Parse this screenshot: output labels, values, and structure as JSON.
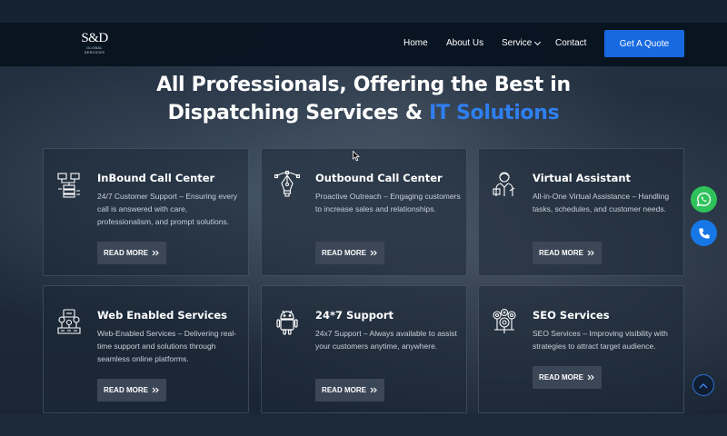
{
  "logo": {
    "mark": "S&D",
    "sub1": "GLOBAL",
    "sub2": "SERVICES"
  },
  "nav": {
    "home": "Home",
    "about": "About Us",
    "service": "Service",
    "contact": "Contact",
    "quote_button": "Get A Quote"
  },
  "heading": {
    "line1": "All Professionals, Offering the Best in",
    "line2_prefix": "Dispatching Services & ",
    "line2_accent": "IT Solutions"
  },
  "cards": [
    {
      "title": "InBound Call Center",
      "description": "24/7 Customer Support – Ensuring every call is answered with care, professionalism, and prompt solutions.",
      "button": "READ MORE",
      "icon": "server-stack-icon"
    },
    {
      "title": "Outbound Call Center",
      "description": "Proactive Outreach – Engaging customers to increase sales and relationships.",
      "button": "READ MORE",
      "icon": "pen-tool-icon"
    },
    {
      "title": "Virtual Assistant",
      "description": "All-in-One Virtual Assistance – Handling tasks, schedules, and customer needs.",
      "button": "READ MORE",
      "icon": "assistant-person-icon"
    },
    {
      "title": "Web Enabled Services",
      "description": "Web-Enabled Services – Delivering real-time support and solutions through seamless online platforms.",
      "button": "READ MORE",
      "icon": "web-services-icon"
    },
    {
      "title": "24*7 Support",
      "description": "24x7 Support – Always available to assist your customers anytime, anywhere.",
      "button": "READ MORE",
      "icon": "android-icon"
    },
    {
      "title": "SEO Services",
      "description": "SEO Services – Improving visibility with strategies to attract target audience.",
      "button": "READ MORE",
      "icon": "seo-gears-icon"
    }
  ],
  "colors": {
    "accent": "#1769e0",
    "heading_accent": "#2f7ff0",
    "whatsapp": "#2fc25b",
    "phone": "#1877e6"
  }
}
